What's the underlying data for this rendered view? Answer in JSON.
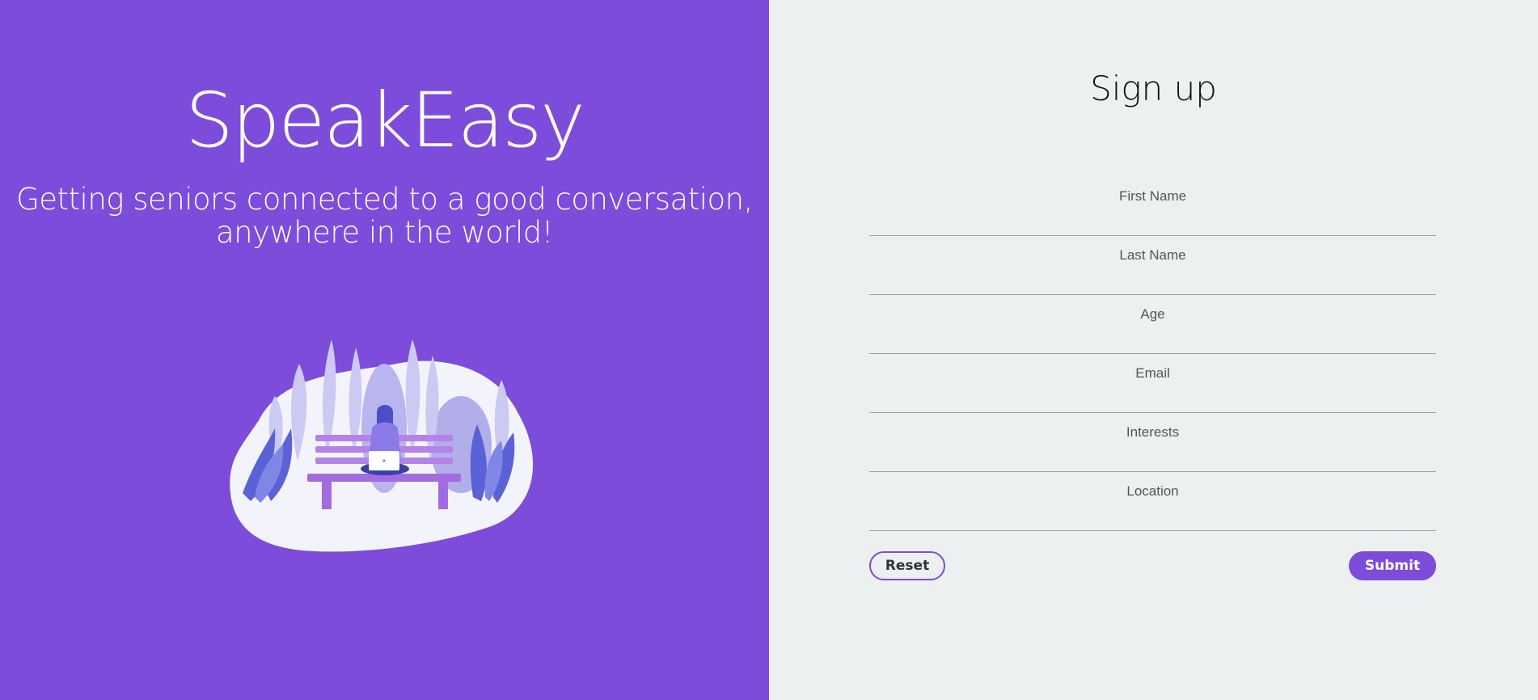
{
  "hero": {
    "title": "SpeakEasy",
    "tagline_line1": "Getting seniors connected to a good conversation,",
    "tagline_line2": "anywhere in the world!",
    "illustration": "person-on-bench-with-laptop"
  },
  "signup": {
    "title": "Sign up",
    "fields": {
      "first_name": "First Name",
      "last_name": "Last Name",
      "age": "Age",
      "email": "Email",
      "interests": "Interests",
      "location": "Location"
    },
    "reset_label": "Reset",
    "submit_label": "Submit"
  },
  "colors": {
    "accent": "#7d4cdb",
    "form_background": "#ecf0f1"
  }
}
